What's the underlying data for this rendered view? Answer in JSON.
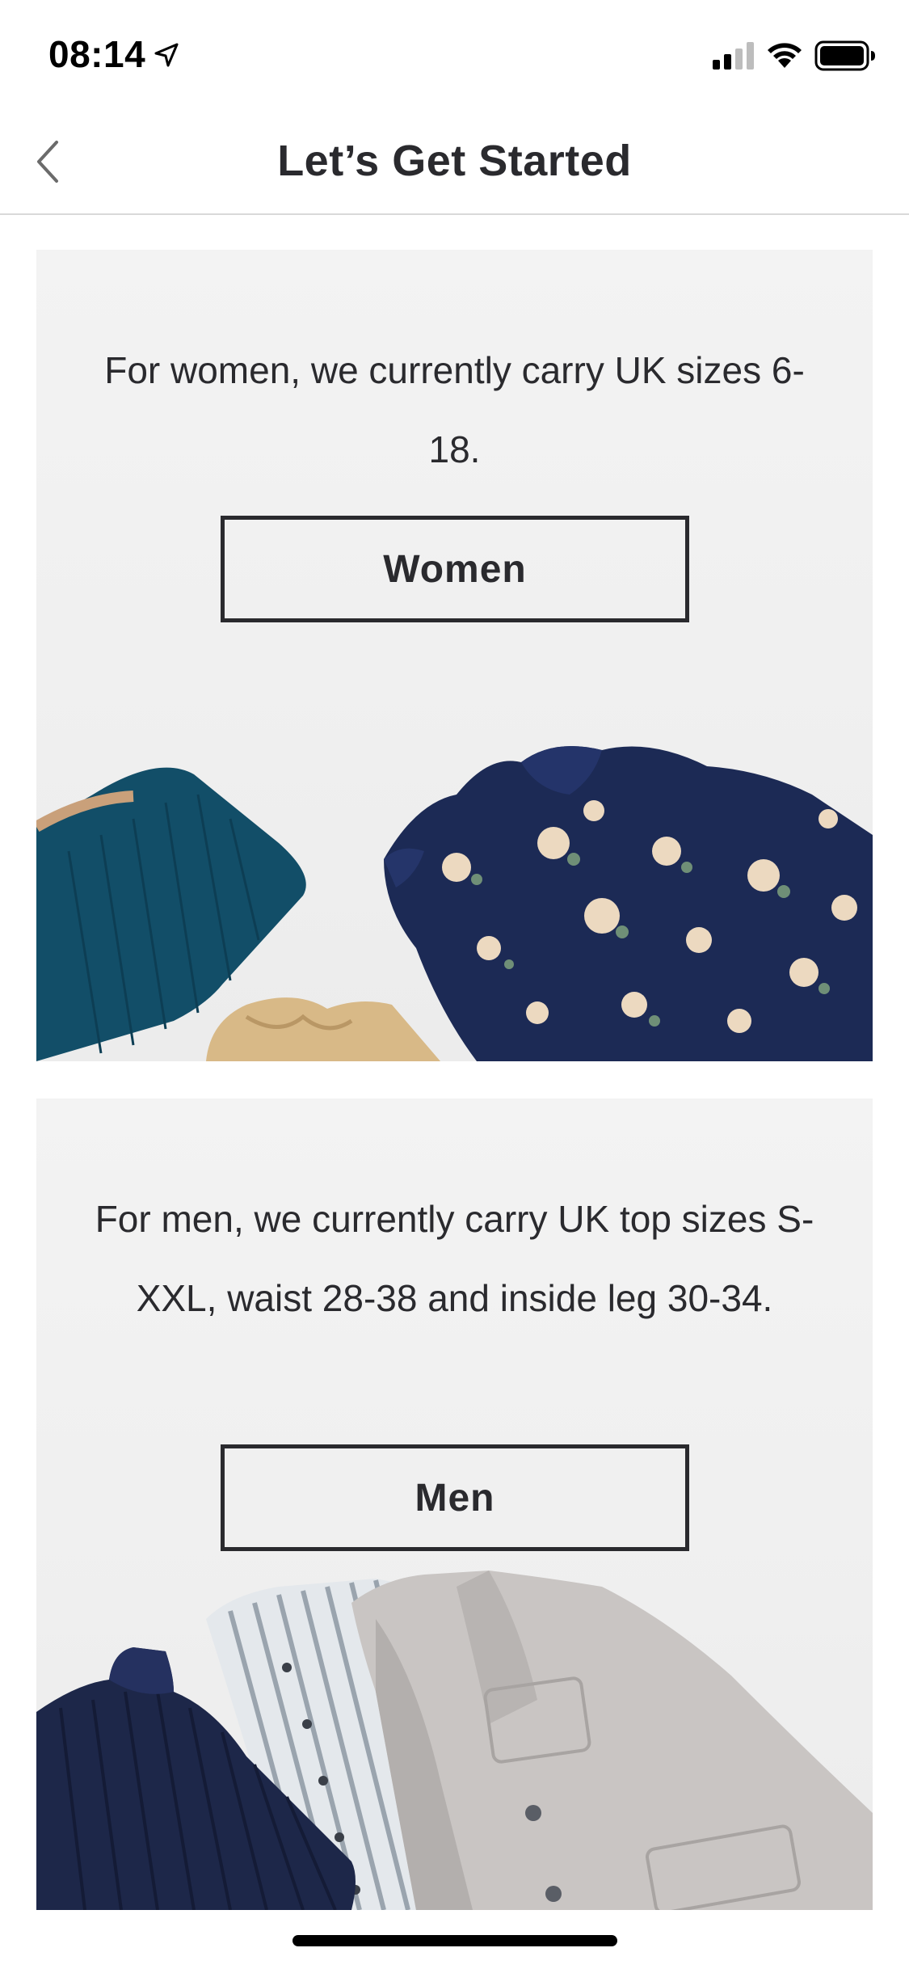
{
  "status_bar": {
    "time": "08:14",
    "icons": [
      "location-arrow-icon",
      "cellular-signal-icon",
      "wifi-icon",
      "battery-icon"
    ]
  },
  "nav": {
    "title": "Let’s Get Started",
    "back_icon": "chevron-left-icon"
  },
  "cards": [
    {
      "id": "women",
      "description": "For women, we currently carry UK sizes 6-18.",
      "button_label": "Women",
      "image_subject": "folded women's clothing: teal knit sweater, gold satin top, navy floral blouse"
    },
    {
      "id": "men",
      "description": "For men, we currently carry UK top sizes S-XXL, waist 28-38 and inside leg 30-34.",
      "button_label": "Men",
      "image_subject": "folded men's clothing: navy ribbed turtleneck, striped shirt, grey blazer"
    }
  ],
  "colors": {
    "text": "#2a2a2e",
    "card_background": "#f2f2f2",
    "divider": "#d9d9d9"
  }
}
